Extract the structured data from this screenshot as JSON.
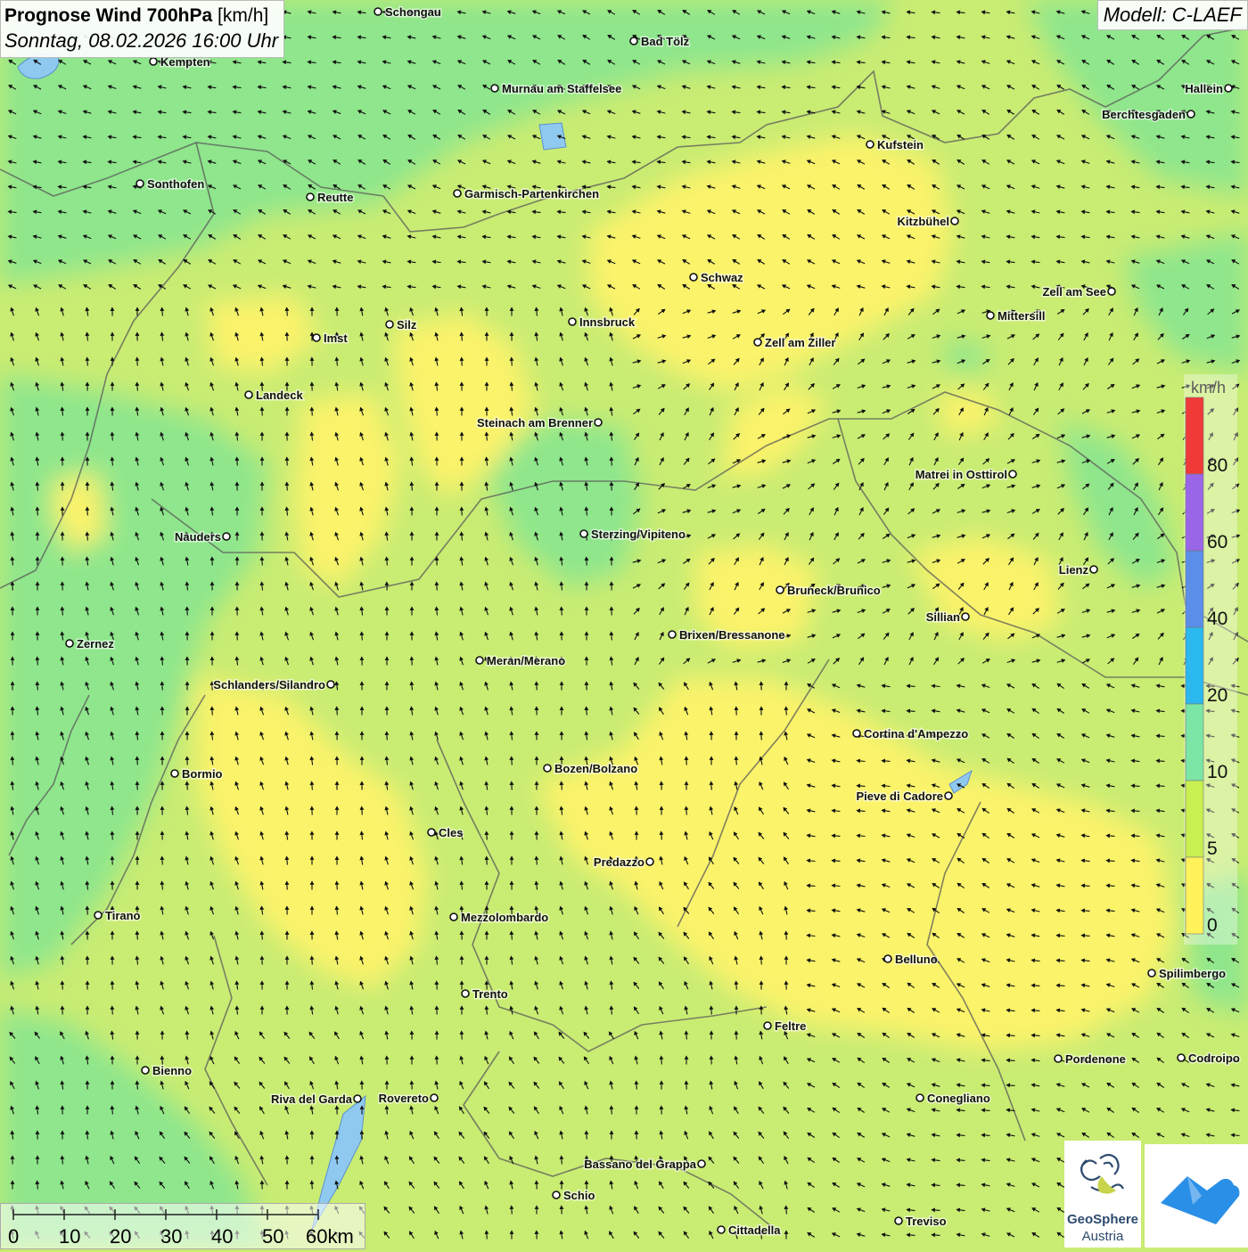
{
  "header": {
    "title_bold": "Prognose Wind 700hPa",
    "title_unit": "[km/h]",
    "datetime": "Sonntag, 08.02.2026 16:00 Uhr",
    "model": "Modell: C-LAEF"
  },
  "legend": {
    "unit": "km/h",
    "ticks": [
      "80",
      "60",
      "40",
      "20",
      "10",
      "5",
      "0"
    ],
    "colors": [
      "#f03a3a",
      "#9a66e8",
      "#5a8ee8",
      "#2ab8ee",
      "#7be6a6",
      "#c8f050",
      "#fff25a"
    ]
  },
  "scale_bar": {
    "labels": [
      "0",
      "10",
      "20",
      "30",
      "40",
      "50",
      "60km"
    ]
  },
  "logos": {
    "geosphere_line1": "GeoSphere",
    "geosphere_line2": "Austria",
    "geosphere_icon": "geosphere-swirl-icon",
    "cloud_icon": "cloud-mountain-icon"
  },
  "cities": [
    {
      "name": "Schongau"
    },
    {
      "name": "Bad Tölz"
    },
    {
      "name": "Kempten"
    },
    {
      "name": "Murnau am Staffelsee"
    },
    {
      "name": "Hallein"
    },
    {
      "name": "Berchtesgaden"
    },
    {
      "name": "Kufstein"
    },
    {
      "name": "Sonthofen"
    },
    {
      "name": "Reutte"
    },
    {
      "name": "Garmisch-Partenkirchen"
    },
    {
      "name": "Kitzbühel"
    },
    {
      "name": "Schwaz"
    },
    {
      "name": "Zell am See"
    },
    {
      "name": "Mittersill"
    },
    {
      "name": "Silz"
    },
    {
      "name": "Innsbruck"
    },
    {
      "name": "Imst"
    },
    {
      "name": "Zell am Ziller"
    },
    {
      "name": "Landeck"
    },
    {
      "name": "Steinach am Brenner"
    },
    {
      "name": "Matrei in Osttirol"
    },
    {
      "name": "Nauders"
    },
    {
      "name": "Sterzing/Vipiteno"
    },
    {
      "name": "Lienz"
    },
    {
      "name": "Bruneck/Brunico"
    },
    {
      "name": "Sillian"
    },
    {
      "name": "Zernez"
    },
    {
      "name": "Brixen/Bressanone"
    },
    {
      "name": "Meran/Merano"
    },
    {
      "name": "Schlanders/Silandro"
    },
    {
      "name": "Cortina d'Ampezzo"
    },
    {
      "name": "Bormio"
    },
    {
      "name": "Bozen/Bolzano"
    },
    {
      "name": "Pieve di Cadore"
    },
    {
      "name": "Cles"
    },
    {
      "name": "Predazzo"
    },
    {
      "name": "Tirano"
    },
    {
      "name": "Mezzolombardo"
    },
    {
      "name": "Belluno"
    },
    {
      "name": "Spilimbergo"
    },
    {
      "name": "Trento"
    },
    {
      "name": "Feltre"
    },
    {
      "name": "Bienno"
    },
    {
      "name": "Pordenone"
    },
    {
      "name": "Codroipo"
    },
    {
      "name": "Riva del Garda"
    },
    {
      "name": "Rovereto"
    },
    {
      "name": "Conegliano"
    },
    {
      "name": "Bassano del Grappa"
    },
    {
      "name": "Schio"
    },
    {
      "name": "Treviso"
    },
    {
      "name": "Cittadella"
    }
  ]
}
